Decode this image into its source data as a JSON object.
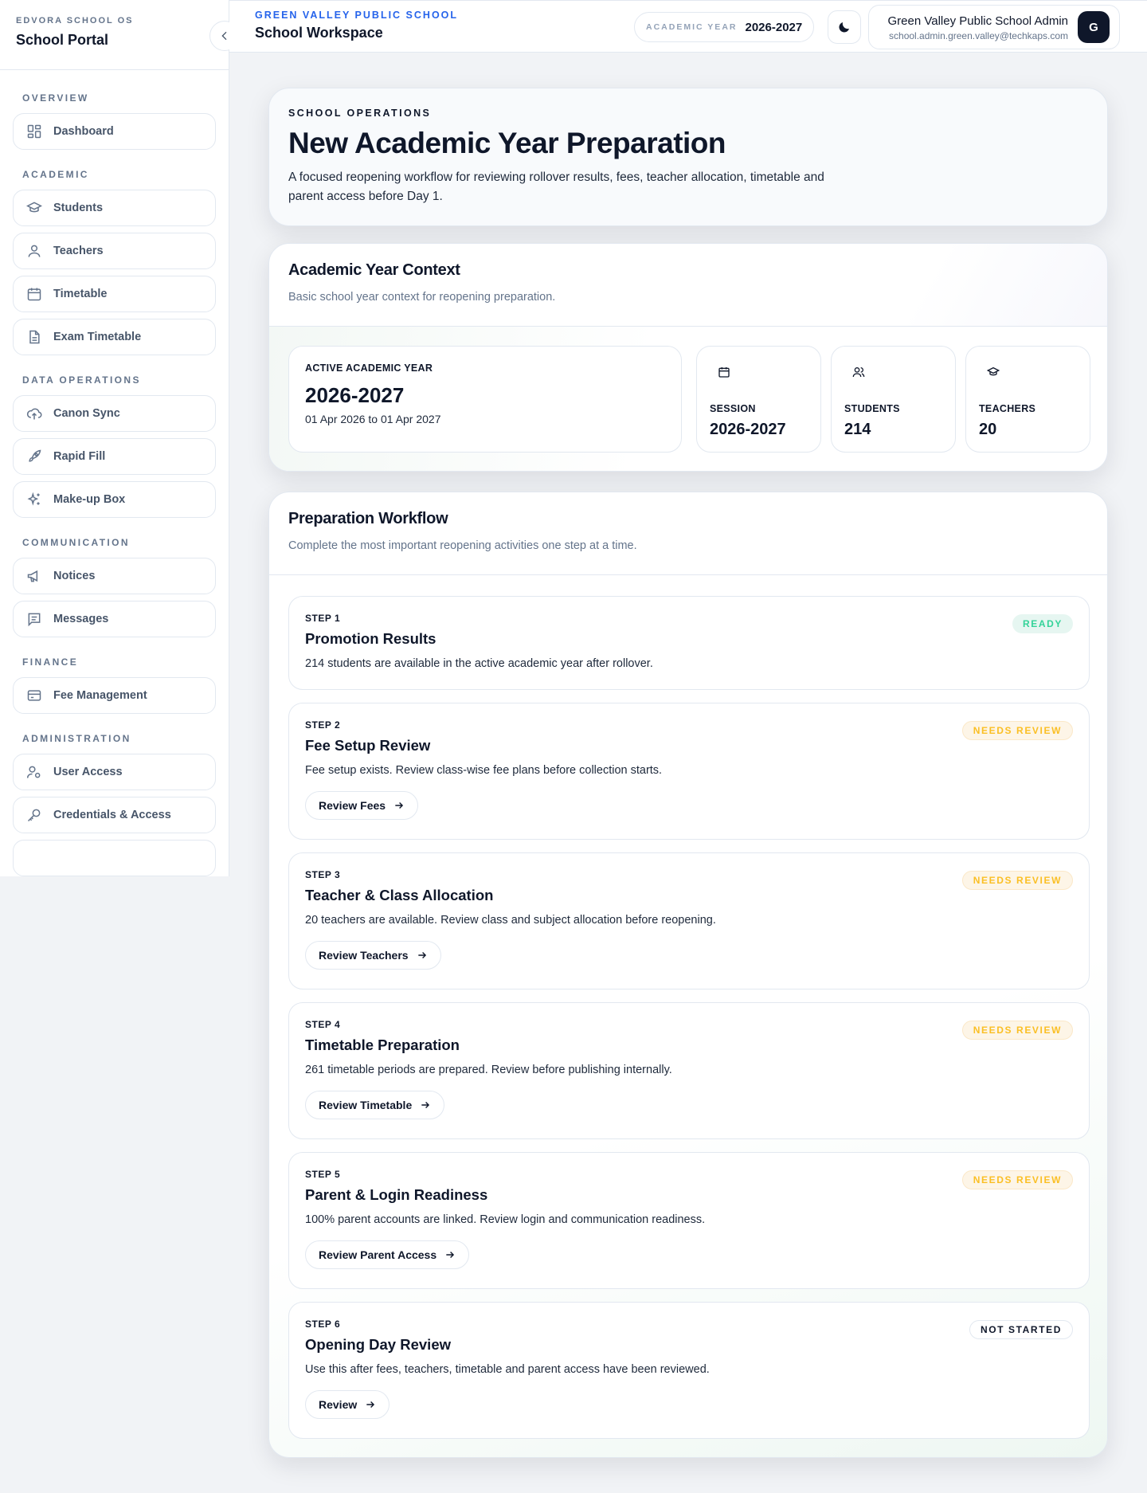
{
  "sidebar": {
    "kicker": "EDVORA SCHOOL OS",
    "title": "School Portal",
    "sections": [
      {
        "label": "OVERVIEW",
        "items": [
          {
            "label": "Dashboard",
            "icon": "dashboard-icon"
          }
        ]
      },
      {
        "label": "ACADEMIC",
        "items": [
          {
            "label": "Students",
            "icon": "graduation-cap-icon"
          },
          {
            "label": "Teachers",
            "icon": "user-icon"
          },
          {
            "label": "Timetable",
            "icon": "calendar-icon"
          },
          {
            "label": "Exam Timetable",
            "icon": "document-icon"
          }
        ]
      },
      {
        "label": "DATA OPERATIONS",
        "items": [
          {
            "label": "Canon Sync",
            "icon": "cloud-upload-icon"
          },
          {
            "label": "Rapid Fill",
            "icon": "rocket-icon"
          },
          {
            "label": "Make-up Box",
            "icon": "sparkles-icon"
          }
        ]
      },
      {
        "label": "COMMUNICATION",
        "items": [
          {
            "label": "Notices",
            "icon": "megaphone-icon"
          },
          {
            "label": "Messages",
            "icon": "message-icon"
          }
        ]
      },
      {
        "label": "FINANCE",
        "items": [
          {
            "label": "Fee Management",
            "icon": "credit-card-icon"
          }
        ]
      },
      {
        "label": "ADMINISTRATION",
        "items": [
          {
            "label": "User Access",
            "icon": "user-settings-icon"
          },
          {
            "label": "Credentials & Access",
            "icon": "key-icon"
          }
        ]
      }
    ]
  },
  "header": {
    "school_name": "GREEN VALLEY PUBLIC SCHOOL",
    "workspace": "School Workspace",
    "year_label": "ACADEMIC YEAR",
    "year_value": "2026-2027",
    "user_name": "Green Valley Public School Admin",
    "user_email": "school.admin.green.valley@techkaps.com",
    "avatar_initial": "G"
  },
  "hero": {
    "kicker": "SCHOOL OPERATIONS",
    "title": "New Academic Year Preparation",
    "description": "A focused reopening workflow for reviewing rollover results, fees, teacher allocation, timetable and parent access before Day 1."
  },
  "context": {
    "title": "Academic Year Context",
    "subtitle": "Basic school year context for reopening preparation.",
    "active_label": "ACTIVE ACADEMIC YEAR",
    "active_year": "2026-2027",
    "active_range": "01 Apr 2026 to 01 Apr 2027",
    "session_label": "SESSION",
    "session_value": "2026-2027",
    "students_label": "STUDENTS",
    "students_value": "214",
    "teachers_label": "TEACHERS",
    "teachers_value": "20"
  },
  "workflow": {
    "title": "Preparation Workflow",
    "subtitle": "Complete the most important reopening activities one step at a time.",
    "steps": [
      {
        "num": "STEP 1",
        "title": "Promotion Results",
        "desc": "214 students are available in the active academic year after rollover.",
        "badge": "READY",
        "button": ""
      },
      {
        "num": "STEP 2",
        "title": "Fee Setup Review",
        "desc": "Fee setup exists. Review class-wise fee plans before collection starts.",
        "badge": "NEEDS REVIEW",
        "button": "Review Fees"
      },
      {
        "num": "STEP 3",
        "title": "Teacher & Class Allocation",
        "desc": "20 teachers are available. Review class and subject allocation before reopening.",
        "badge": "NEEDS REVIEW",
        "button": "Review Teachers"
      },
      {
        "num": "STEP 4",
        "title": "Timetable Preparation",
        "desc": "261 timetable periods are prepared. Review before publishing internally.",
        "badge": "NEEDS REVIEW",
        "button": "Review Timetable"
      },
      {
        "num": "STEP 5",
        "title": "Parent & Login Readiness",
        "desc": "100% parent accounts are linked. Review login and communication readiness.",
        "badge": "NEEDS REVIEW",
        "button": "Review Parent Access"
      },
      {
        "num": "STEP 6",
        "title": "Opening Day Review",
        "desc": "Use this after fees, teachers, timetable and parent access have been reviewed.",
        "badge": "NOT STARTED",
        "button": "Review"
      }
    ]
  }
}
